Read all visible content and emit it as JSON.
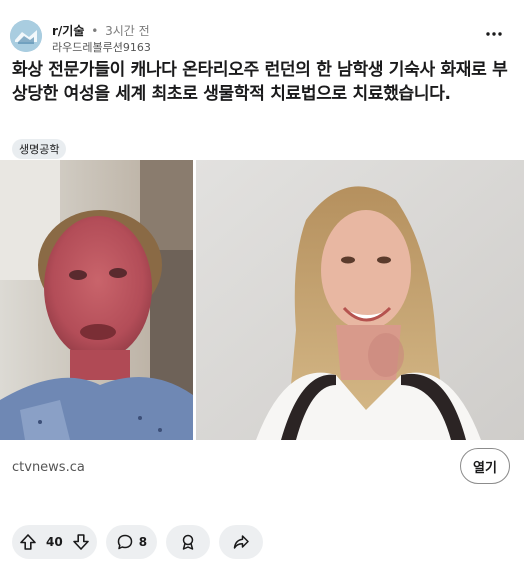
{
  "post": {
    "subreddit": "r/기술",
    "separator": "•",
    "time_ago": "3시간 전",
    "username": "라우드레볼루션9163",
    "title": "화상 전문가들이 캐나다 온타리오주 런던의 한 남학생 기숙사 화재로 부상당한 여성을 세계 최초로 생물학적 치료법으로 치료했습니다.",
    "flair": "생명공학",
    "link_domain": "ctvnews.ca",
    "open_label": "열기",
    "vote_count": "40",
    "comment_count": "8"
  },
  "icons": {
    "avatar": "subreddit-avatar-icon",
    "more": "more-options-icon",
    "upvote": "upvote-arrow-icon",
    "downvote": "downvote-arrow-icon",
    "comment": "comment-bubble-icon",
    "award": "award-icon",
    "share": "share-arrow-icon"
  },
  "colors": {
    "pill_bg": "#edeff1",
    "flair_bg": "#e9edf0",
    "meta_gray": "#7c7c7c"
  }
}
